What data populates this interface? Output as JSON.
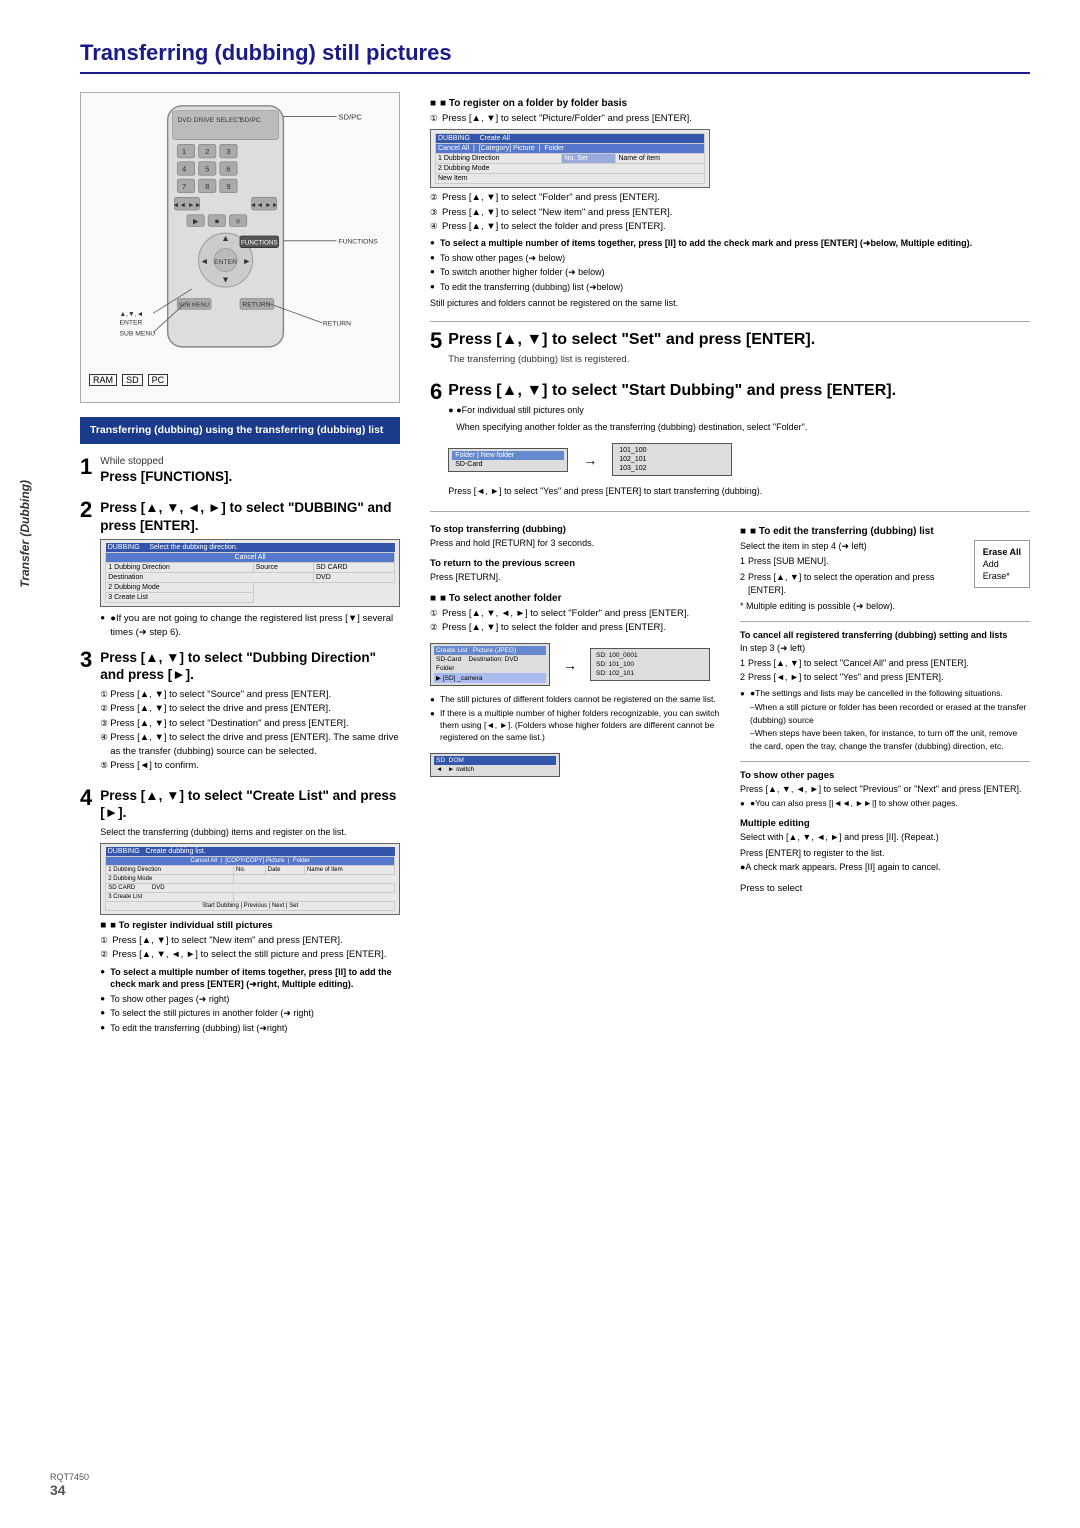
{
  "page": {
    "title": "Transferring (dubbing) still pictures",
    "side_label": "Transfer (Dubbing)",
    "page_number": "34",
    "model_code": "RQT7450"
  },
  "header": {
    "badges": [
      "RAM",
      "SD",
      "PC"
    ]
  },
  "blue_box": {
    "text": "Transferring (dubbing) using the transferring (dubbing) list"
  },
  "steps": {
    "step1": {
      "number": "1",
      "label": "While stopped",
      "title": "Press [FUNCTIONS]."
    },
    "step2": {
      "number": "2",
      "title": "Press [▲, ▼, ◄, ►] to select \"DUBBING\" and press [ENTER].",
      "note1": "●If you are not going to change the registered list press [▼] several times (➜ step 6)."
    },
    "step3": {
      "number": "3",
      "title": "Press [▲, ▼] to select \"Dubbing Direction\" and press [►].",
      "sub": [
        "Press [▲, ▼] to select \"Source\" and press [ENTER].",
        "Press [▲, ▼] to select the drive and press [ENTER].",
        "Press [▲, ▼] to select \"Destination\" and press [ENTER].",
        "Press [▲, ▼] to select the drive and press [ENTER]. The same drive as the transfer (dubbing) source can be selected.",
        "Press [◄] to confirm."
      ]
    },
    "step4": {
      "number": "4",
      "title": "Press [▲, ▼] to select \"Create List\" and press [►].",
      "desc": "Select the transferring (dubbing) items and register on the list.",
      "register_individual": {
        "title": "■ To register individual still pictures",
        "items": [
          "Press [▲, ▼] to select \"New item\" and press [ENTER].",
          "Press [▲, ▼, ◄, ►] to select the still picture and press [ENTER]."
        ],
        "notes": [
          "To select a multiple number of items together, press [II] to add the check mark and press [ENTER] (➜right, Multiple editing).",
          "To show other pages (➜ right)",
          "To select the still pictures in another folder (➜ right)",
          "To edit the transferring (dubbing) list (➜right)"
        ]
      }
    },
    "step5": {
      "number": "5",
      "title": "Press [▲, ▼] to select \"Set\" and press [ENTER].",
      "desc": "The transferring (dubbing) list is registered."
    },
    "step6": {
      "number": "6",
      "title": "Press [▲, ▼] to select \"Start Dubbing\" and press [ENTER].",
      "note": "●For individual still pictures only",
      "folder_note": "When specifying another folder as the transferring (dubbing) destination, select \"Folder\".",
      "confirm_note": "Press [◄, ►] to select \"Yes\" and press [ENTER] to start transferring (dubbing)."
    }
  },
  "right_sections": {
    "folder_by_folder": {
      "title": "■ To register on a folder by folder basis",
      "items": [
        "Press [▲, ▼] to select \"Picture/Folder\" and press [ENTER].",
        "Press [▲, ▼] to select \"Folder\" and press [ENTER].",
        "Press [▲, ▼] to select \"New item\" and press [ENTER].",
        "Press [▲, ▼] to select the folder and press [ENTER]."
      ],
      "notes": [
        "To select a multiple number of items together, press [II] to add the check mark and press [ENTER] (➜below, Multiple editing).",
        "To show other pages (➜ below)",
        "To switch another higher folder (➜ below)",
        "To edit the transferring (dubbing) list (➜below)"
      ],
      "footer": "Still pictures and folders cannot be registered on the same list."
    },
    "stop_transferring": {
      "title": "To stop transferring (dubbing)",
      "desc": "Press and hold [RETURN] for 3 seconds."
    },
    "return_previous": {
      "title": "To return to the previous screen",
      "desc": "Press [RETURN]."
    },
    "select_another_folder": {
      "title": "■ To select another folder",
      "items": [
        "Press [▲, ▼, ◄, ►] to select \"Folder\" and press [ENTER].",
        "Press [▲, ▼] to select the folder and press [ENTER]."
      ],
      "notes": [
        "The still pictures of different folders cannot be registered on the same list.",
        "If there is a multiple number of higher folders recognizable, you can switch them using [◄, ►]. (Folders whose higher folders are different cannot be registered on the same list.)"
      ]
    },
    "edit_list": {
      "title": "■ To edit the transferring (dubbing) list",
      "desc": "Select the item in step 4 (➜ left)",
      "items": [
        "Press [SUB MENU].",
        "Press [▲, ▼] to select the operation and press [ENTER]."
      ],
      "note": "* Multiple editing is possible (➜ below).",
      "buttons": [
        "Erase All",
        "Add",
        "Erase*"
      ]
    },
    "cancel_all": {
      "title": "To cancel all registered transferring (dubbing) setting and lists",
      "intro": "In step 3 (➜ left)",
      "items": [
        "Press [▲, ▼] to select \"Cancel All\" and press [ENTER].",
        "Press [◄, ►] to select \"Yes\" and press [ENTER]."
      ],
      "note": "●The settings and lists may be cancelled in the following situations.",
      "subnotes": [
        "–When a still picture or folder has been recorded or erased at the transfer (dubbing) source",
        "–When steps have been taken, for instance, to turn off the unit, remove the card, open the tray, change the transfer (dubbing) direction, etc."
      ]
    },
    "show_other_pages": {
      "title": "To show other pages",
      "desc": "Press [▲, ▼, ◄, ►] to select \"Previous\" or \"Next\" and press [ENTER].",
      "note": "●You can also press [|◄◄, ►►|] to show other pages."
    },
    "multiple_editing": {
      "title": "Multiple editing",
      "desc": "Select with [▲, ▼, ◄, ►] and press [II]. (Repeat.)",
      "items": [
        "Press [ENTER] to register to the list.",
        "●A check mark appears. Press [II] again to cancel."
      ]
    },
    "press_to_select": "Press to select"
  },
  "remote": {
    "labels": {
      "sd_pc": "SD/PC",
      "functions": "FUNCTIONS",
      "enter": "ENTER",
      "sub_menu": "SUB MENU",
      "return_label": "RETURN"
    }
  }
}
